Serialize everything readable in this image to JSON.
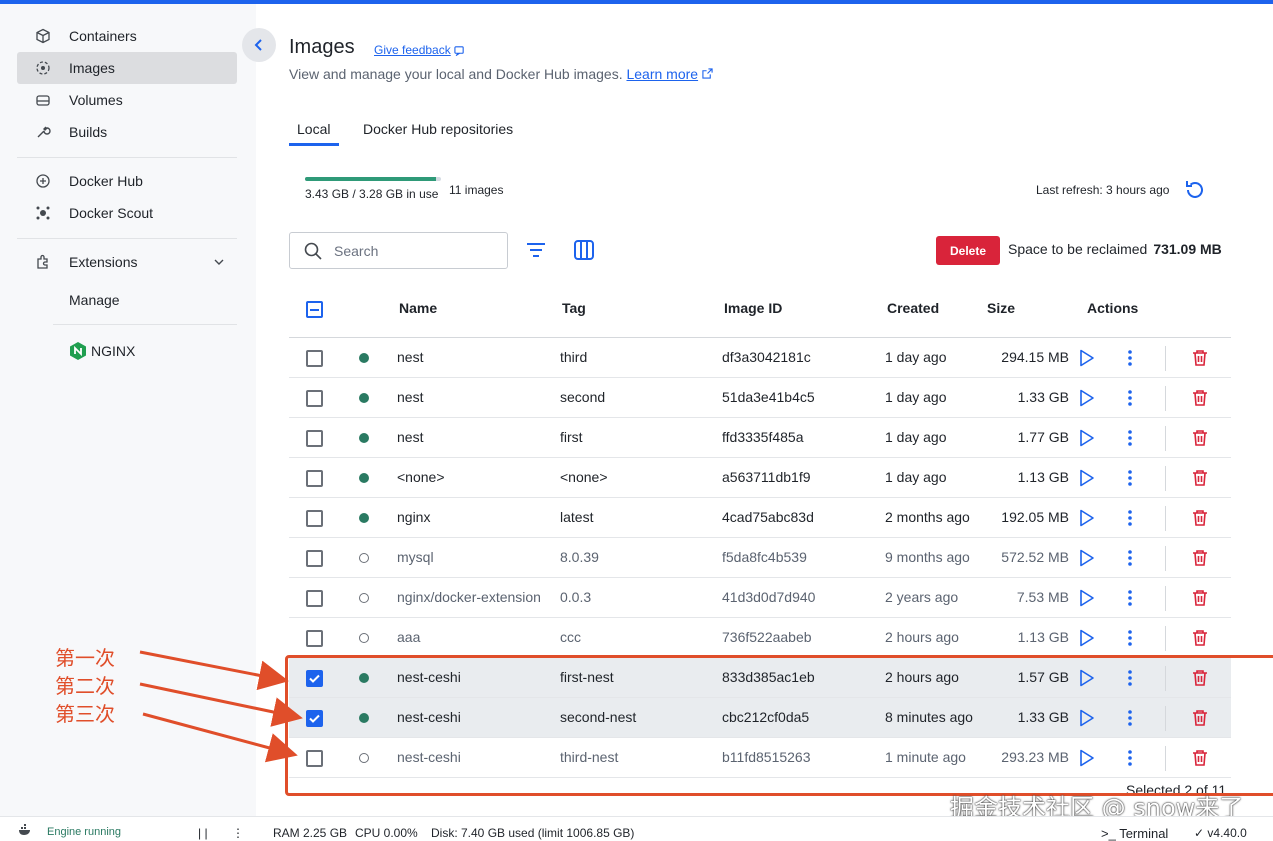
{
  "sidebar": {
    "items": [
      {
        "label": "Containers",
        "icon": "container-icon"
      },
      {
        "label": "Images",
        "icon": "images-icon",
        "active": true
      },
      {
        "label": "Volumes",
        "icon": "volumes-icon"
      },
      {
        "label": "Builds",
        "icon": "builds-icon"
      },
      {
        "label": "Docker Hub",
        "icon": "docker-hub-icon"
      },
      {
        "label": "Docker Scout",
        "icon": "docker-scout-icon"
      }
    ],
    "extensions_label": "Extensions",
    "manage_label": "Manage",
    "nginx_label": "NGINX"
  },
  "header": {
    "title": "Images",
    "feedback": "Give feedback",
    "subtitle": "View and manage your local and Docker Hub images.",
    "learn_more": "Learn more"
  },
  "tabs": [
    {
      "label": "Local",
      "active": true
    },
    {
      "label": "Docker Hub repositories"
    }
  ],
  "usage": {
    "text": "3.43 GB / 3.28 GB in use",
    "fill_fraction": 0.96,
    "count": "11 images",
    "last_refresh": "Last refresh: 3 hours ago"
  },
  "toolbar": {
    "search_placeholder": "Search",
    "delete_label": "Delete",
    "reclaim_label": "Space to be reclaimed",
    "reclaim_value": "731.09 MB"
  },
  "table": {
    "headers": {
      "name": "Name",
      "tag": "Tag",
      "id": "Image ID",
      "created": "Created",
      "size": "Size",
      "actions": "Actions"
    },
    "rows": [
      {
        "name": "nest",
        "tag": "third",
        "id": "df3a3042181c",
        "created": "1 day ago",
        "size": "294.15 MB",
        "in_use": true,
        "selected": false
      },
      {
        "name": "nest",
        "tag": "second",
        "id": "51da3e41b4c5",
        "created": "1 day ago",
        "size": "1.33 GB",
        "in_use": true,
        "selected": false
      },
      {
        "name": "nest",
        "tag": "first",
        "id": "ffd3335f485a",
        "created": "1 day ago",
        "size": "1.77 GB",
        "in_use": true,
        "selected": false
      },
      {
        "name": "<none>",
        "tag": "<none>",
        "id": "a563711db1f9",
        "created": "1 day ago",
        "size": "1.13 GB",
        "in_use": true,
        "selected": false
      },
      {
        "name": "nginx",
        "tag": "latest",
        "id": "4cad75abc83d",
        "created": "2 months ago",
        "size": "192.05 MB",
        "in_use": true,
        "selected": false
      },
      {
        "name": "mysql",
        "tag": "8.0.39",
        "id": "f5da8fc4b539",
        "created": "9 months ago",
        "size": "572.52 MB",
        "in_use": false,
        "selected": false
      },
      {
        "name": "nginx/docker-extension",
        "tag": "0.0.3",
        "id": "41d3d0d7d940",
        "created": "2 years ago",
        "size": "7.53 MB",
        "in_use": false,
        "selected": false
      },
      {
        "name": "aaa",
        "tag": "ccc",
        "id": "736f522aabeb",
        "created": "2 hours ago",
        "size": "1.13 GB",
        "in_use": false,
        "selected": false
      },
      {
        "name": "nest-ceshi",
        "tag": "first-nest",
        "id": "833d385ac1eb",
        "created": "2 hours ago",
        "size": "1.57 GB",
        "in_use": true,
        "selected": true
      },
      {
        "name": "nest-ceshi",
        "tag": "second-nest",
        "id": "cbc212cf0da5",
        "created": "8 minutes ago",
        "size": "1.33 GB",
        "in_use": true,
        "selected": true
      },
      {
        "name": "nest-ceshi",
        "tag": "third-nest",
        "id": "b11fd8515263",
        "created": "1 minute ago",
        "size": "293.23 MB",
        "in_use": false,
        "selected": false
      }
    ],
    "selected_text": "Selected 2 of 11"
  },
  "annotations": {
    "labels": [
      "第一次",
      "第二次",
      "第三次"
    ],
    "color": "#e04e2a"
  },
  "footer": {
    "engine": "Engine running",
    "ram": "RAM 2.25 GB",
    "cpu": "CPU 0.00%",
    "disk": "Disk: 7.40 GB used (limit 1006.85 GB)",
    "terminal": ">_ Terminal",
    "version": "✓ v4.40.0"
  },
  "watermark": "掘金技术社区 @ snow来了",
  "colors": {
    "accent": "#1d63ed",
    "danger": "#d9243a",
    "in_use": "#2a7a62"
  }
}
